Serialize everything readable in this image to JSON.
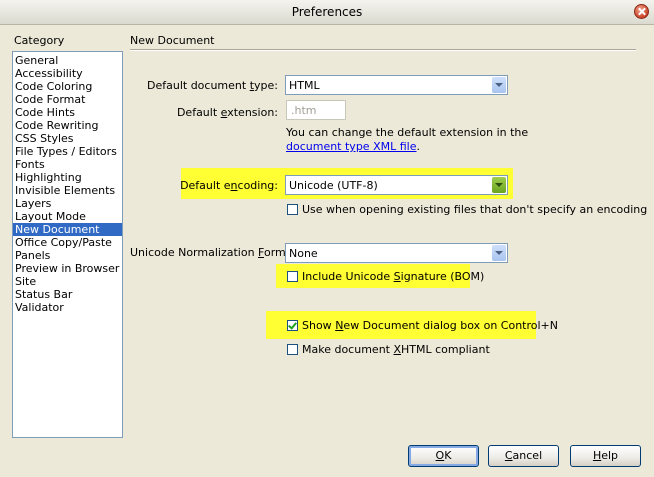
{
  "window": {
    "title": "Preferences"
  },
  "category": {
    "label": "Category",
    "items": [
      "General",
      "Accessibility",
      "Code Coloring",
      "Code Format",
      "Code Hints",
      "Code Rewriting",
      "CSS Styles",
      "File Types / Editors",
      "Fonts",
      "Highlighting",
      "Invisible Elements",
      "Layers",
      "Layout Mode",
      "New Document",
      "Office Copy/Paste",
      "Panels",
      "Preview in Browser",
      "Site",
      "Status Bar",
      "Validator"
    ],
    "selected": "New Document"
  },
  "section": {
    "title": "New Document"
  },
  "doc_type": {
    "label_pre": "Default document ",
    "label_key": "t",
    "label_post": "ype:",
    "value": "HTML"
  },
  "extension": {
    "label_pre": "Default ",
    "label_key": "e",
    "label_post": "xtension:",
    "value": ".htm"
  },
  "info": {
    "text": "You can change the default extension in the",
    "link": "document type XML file",
    "suffix": "."
  },
  "encoding": {
    "label_pre": "Default e",
    "label_key": "n",
    "label_post": "coding:",
    "value": "Unicode (UTF-8)"
  },
  "use_when_opening": {
    "label": "Use when opening existing files that don't specify an encoding",
    "checked": false
  },
  "normalization": {
    "label_pre": "Unicode Normalization ",
    "label_key": "F",
    "label_post": "orm:",
    "value": "None"
  },
  "bom": {
    "label_pre": "Include Unicode ",
    "label_key": "S",
    "label_post": "ignature (BOM)",
    "checked": false
  },
  "show_dialog": {
    "label_pre": "Show ",
    "label_key": "N",
    "label_post": "ew Document dialog box on Control+N",
    "checked": true
  },
  "xhtml": {
    "label_pre": "Make document ",
    "label_key": "X",
    "label_post": "HTML compliant",
    "checked": false
  },
  "buttons": {
    "ok": {
      "label_key": "O",
      "label_post": "K"
    },
    "cancel": {
      "label_key": "C",
      "label_post": "ancel"
    },
    "help": {
      "label_key": "H",
      "label_post": "elp"
    }
  },
  "colors": {
    "highlight": "#ffff33",
    "selection": "#316ac5",
    "link": "#0000ee"
  }
}
